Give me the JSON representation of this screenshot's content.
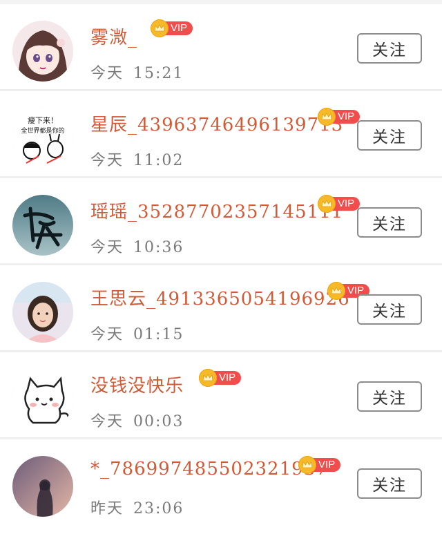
{
  "follow_label": "关注",
  "vip_label": "VIP",
  "users": [
    {
      "name": "雾溦_",
      "day": "今天",
      "time": "15:21",
      "vip": true
    },
    {
      "name": "星辰_43963746496139713",
      "day": "今天",
      "time": "11:02",
      "vip": true
    },
    {
      "name": "瑶瑶_35287702357145111",
      "day": "今天",
      "time": "10:36",
      "vip": true
    },
    {
      "name": "王思云_4913365054196926",
      "day": "今天",
      "time": "01:15",
      "vip": true
    },
    {
      "name": "没钱没快乐",
      "day": "今天",
      "time": "00:03",
      "vip": true
    },
    {
      "name": "*_786997485502321937",
      "day": "昨天",
      "time": "23:06",
      "vip": true
    }
  ],
  "avatar_texts": {
    "user2_line1": "瘦下来！",
    "user2_line2": "全世界都是你的"
  },
  "colors": {
    "name": "#d25a37",
    "vip_tag": "#f24d4d",
    "crown": "#f6b928",
    "time": "#7a7a7a",
    "button_border": "#8c8c8c"
  }
}
